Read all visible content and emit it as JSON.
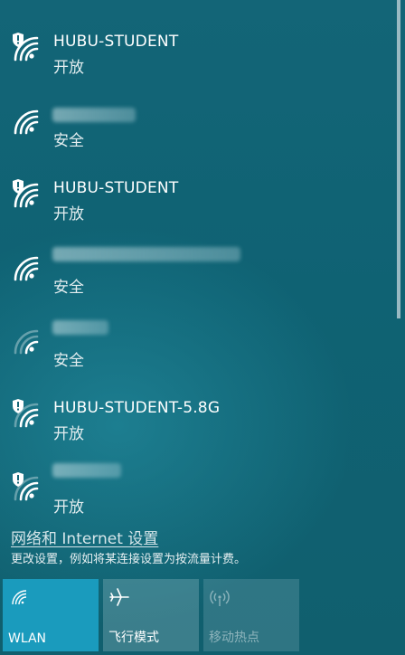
{
  "networks": [
    {
      "ssid": "HUBU-STUDENT",
      "status": "开放",
      "open_shield": true,
      "blurred": false,
      "signal": "strong"
    },
    {
      "ssid": "",
      "status": "安全",
      "open_shield": false,
      "blurred": true,
      "signal": "strong"
    },
    {
      "ssid": "HUBU-STUDENT",
      "status": "开放",
      "open_shield": true,
      "blurred": false,
      "signal": "strong"
    },
    {
      "ssid": "",
      "status": "安全",
      "open_shield": false,
      "blurred": true,
      "signal": "strong"
    },
    {
      "ssid": "",
      "status": "安全",
      "open_shield": false,
      "blurred": true,
      "signal": "weak"
    },
    {
      "ssid": "HUBU-STUDENT-5.8G",
      "status": "开放",
      "open_shield": true,
      "blurred": false,
      "signal": "strong"
    },
    {
      "ssid": "",
      "status": "开放",
      "open_shield": true,
      "blurred": true,
      "signal": "medium"
    }
  ],
  "settings": {
    "link": "网络和 Internet 设置",
    "description": "更改设置，例如将某连接设置为按流量计费。"
  },
  "quick_actions": {
    "wlan": {
      "label": "WLAN",
      "icon": "wifi-icon",
      "active": true
    },
    "airplane": {
      "label": "飞行模式",
      "icon": "airplane-icon",
      "active": false
    },
    "hotspot": {
      "label": "移动热点",
      "icon": "hotspot-icon",
      "active": false,
      "disabled": true
    }
  },
  "colors": {
    "background": "#0f6273",
    "active_tile": "#1a9bbd"
  }
}
